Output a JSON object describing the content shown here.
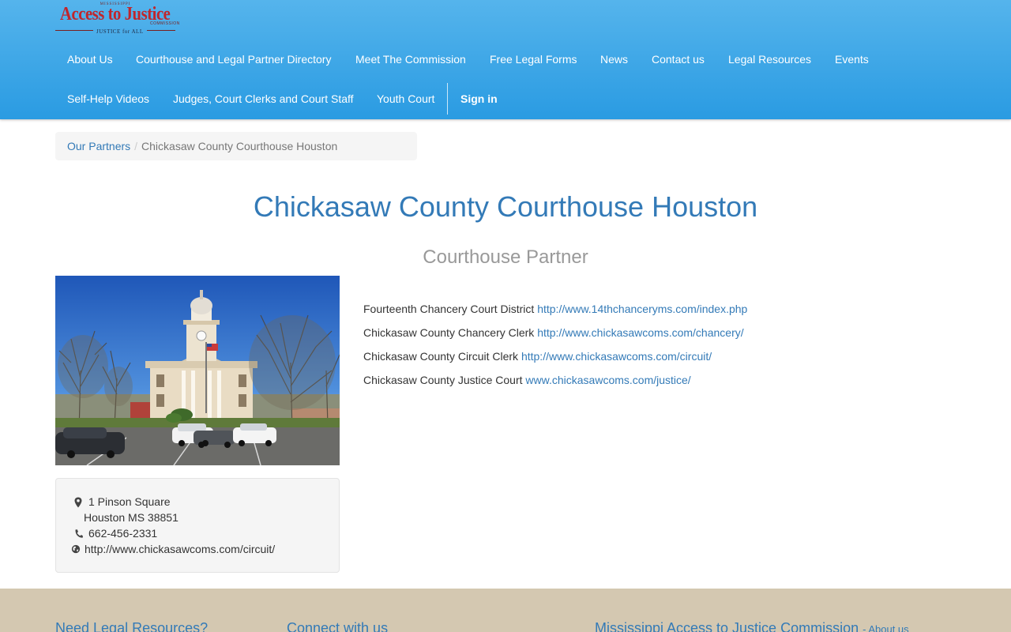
{
  "logo": {
    "top_text": "MISSISSIPPI",
    "name": "Access to Justice",
    "commission": "COMMISSION",
    "tagline": "JUSTICE for ALL"
  },
  "nav": {
    "items": [
      {
        "label": "About Us"
      },
      {
        "label": "Courthouse and Legal Partner Directory"
      },
      {
        "label": "Meet The Commission"
      },
      {
        "label": "Free Legal Forms"
      },
      {
        "label": "News"
      },
      {
        "label": "Contact us"
      },
      {
        "label": "Legal Resources"
      },
      {
        "label": "Events"
      },
      {
        "label": "Self-Help Videos"
      },
      {
        "label": "Judges, Court Clerks and Court Staff"
      },
      {
        "label": "Youth Court"
      }
    ],
    "sign_in": "Sign in"
  },
  "breadcrumb": {
    "parent": "Our Partners",
    "separator": "/",
    "current": "Chickasaw County Courthouse Houston"
  },
  "page": {
    "title": "Chickasaw County Courthouse Houston",
    "subtitle": "Courthouse Partner"
  },
  "address": {
    "street": "1 Pinson Square",
    "city_line": "Houston MS 38851",
    "phone": "662-456-2331",
    "website": "http://www.chickasawcoms.com/circuit/",
    "icons": [
      "map-marker-icon",
      "phone-icon",
      "globe-icon"
    ]
  },
  "links": [
    {
      "label": "Fourteenth Chancery Court District",
      "url": "http://www.14thchanceryms.com/index.php"
    },
    {
      "label": "Chickasaw County Chancery Clerk",
      "url": "http://www.chickasawcoms.com/chancery/"
    },
    {
      "label": "Chickasaw County Circuit Clerk",
      "url": "http://www.chickasawcoms.com/circuit/"
    },
    {
      "label": "Chickasaw County Justice Court",
      "url": "www.chickasawcoms.com/justice/"
    }
  ],
  "footer": {
    "col1": "Need Legal Resources?",
    "col2": "Connect with us",
    "col3": "Mississippi Access to Justice Commission",
    "col3_link": "- About us"
  },
  "colors": {
    "header_top": "#55b4ec",
    "header_bottom": "#2a9be2",
    "link": "#337ab7",
    "footer_bg": "#d4c8b1",
    "logo_red": "#c0262c"
  }
}
